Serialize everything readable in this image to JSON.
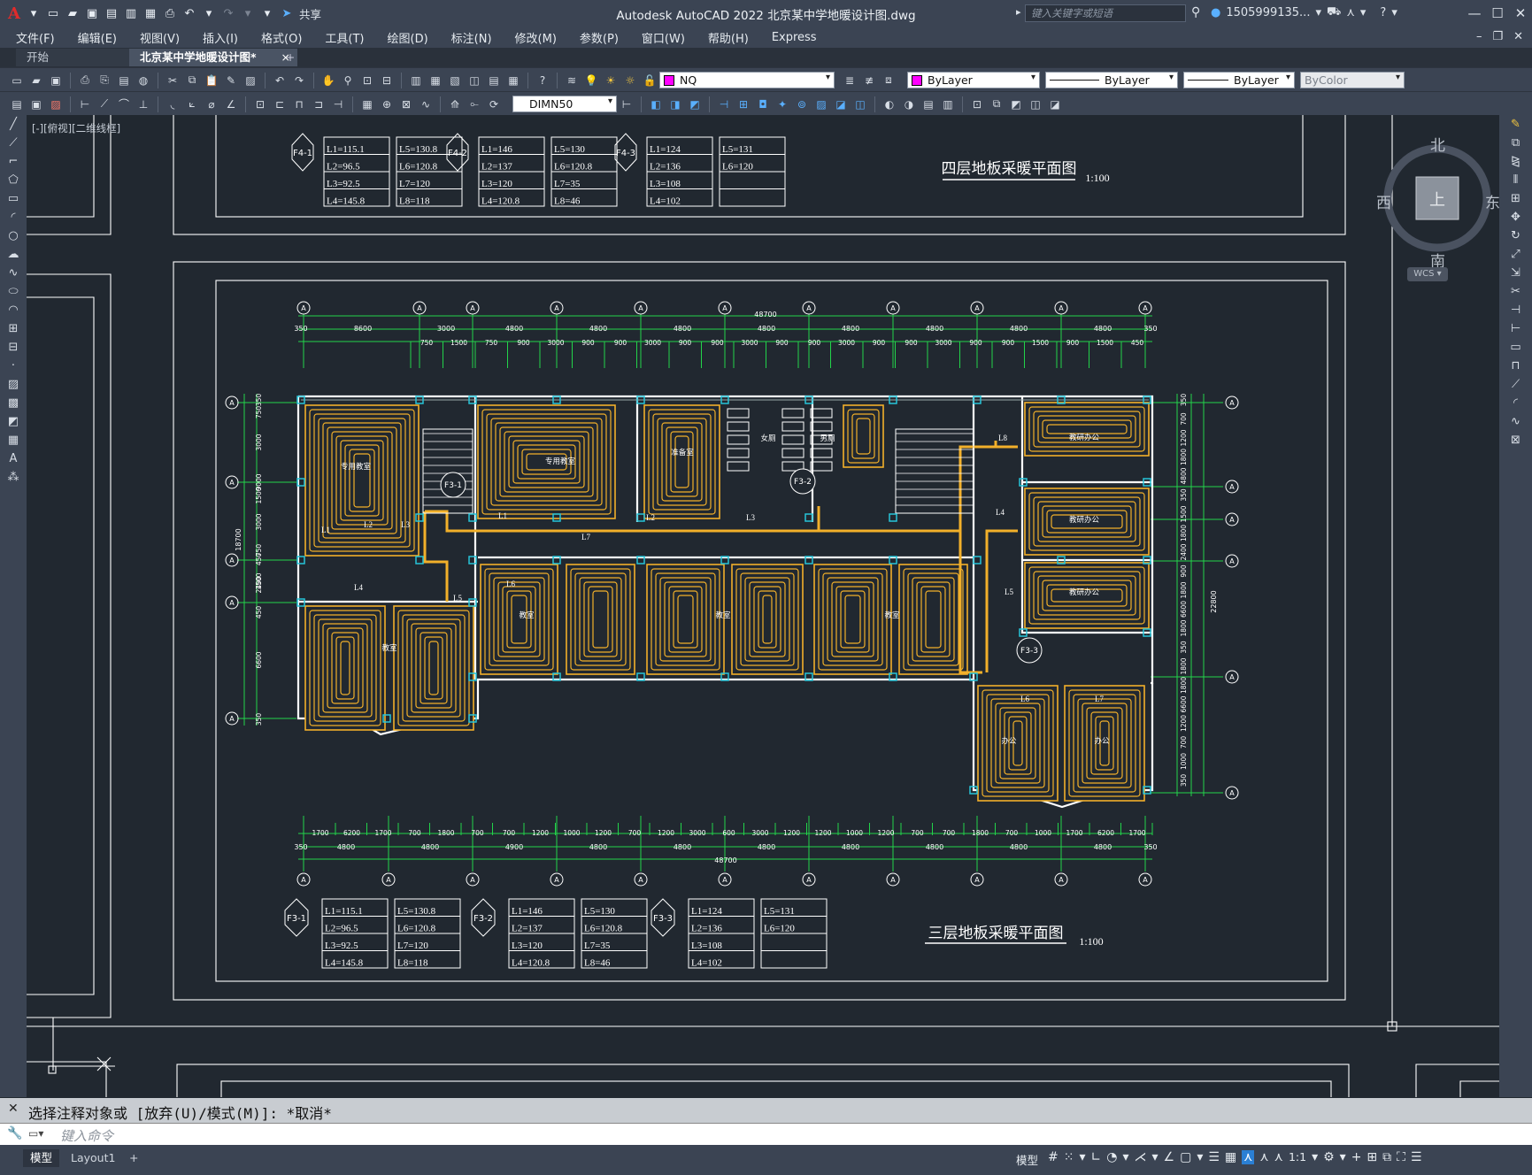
{
  "app": {
    "title": "Autodesk AutoCAD 2022    北京某中学地暖设计图.dwg",
    "search_placeholder": "键入关键字或短语",
    "user": "1505999135...",
    "share_label": "共享"
  },
  "menu": [
    "文件(F)",
    "编辑(E)",
    "视图(V)",
    "插入(I)",
    "格式(O)",
    "工具(T)",
    "绘图(D)",
    "标注(N)",
    "修改(M)",
    "参数(P)",
    "窗口(W)",
    "帮助(H)",
    "Express"
  ],
  "tabs": {
    "start": "开始",
    "doc": "北京某中学地暖设计图*",
    "close": "×",
    "add": "+"
  },
  "toolbar": {
    "layer": "NQ",
    "color": "ByLayer",
    "linetype": "ByLayer",
    "lineweight": "ByLayer",
    "plotstyle": "ByColor",
    "dimstyle": "DIMN50"
  },
  "viewport_label": "[-][俯视][二维线框]",
  "viewcube": {
    "north": "北",
    "south": "南",
    "east": "东",
    "west": "西",
    "top": "上",
    "wcs": "WCS"
  },
  "drawing": {
    "title_4f": "四层地板采暖平面图",
    "scale_4f": "1:100",
    "title_3f": "三层地板采暖平面图",
    "scale_3f": "1:100",
    "axis_label": "A",
    "tables_4f": [
      {
        "tag": "F4-1",
        "col1": [
          "L1=115.1",
          "L2=96.5",
          "L3=92.5",
          "L4=145.8"
        ],
        "col2": [
          "L5=130.8",
          "L6=120.8",
          "L7=120",
          "L8=118"
        ]
      },
      {
        "tag": "F4-2",
        "col1": [
          "L1=146",
          "L2=137",
          "L3=120",
          "L4=120.8"
        ],
        "col2": [
          "L5=130",
          "L6=120.8",
          "L7=35",
          "L8=46"
        ]
      },
      {
        "tag": "F4-3",
        "col1": [
          "L1=124",
          "L2=136",
          "L3=108",
          "L4=102"
        ],
        "col2": [
          "L5=131",
          "L6=120",
          "",
          ""
        ]
      }
    ],
    "tables_3f": [
      {
        "tag": "F3-1",
        "col1": [
          "L1=115.1",
          "L2=96.5",
          "L3=92.5",
          "L4=145.8"
        ],
        "col2": [
          "L5=130.8",
          "L6=120.8",
          "L7=120",
          "L8=118"
        ]
      },
      {
        "tag": "F3-2",
        "col1": [
          "L1=146",
          "L2=137",
          "L3=120",
          "L4=120.8"
        ],
        "col2": [
          "L5=130",
          "L6=120.8",
          "L7=35",
          "L8=46"
        ]
      },
      {
        "tag": "F3-3",
        "col1": [
          "L1=124",
          "L2=136",
          "L3=108",
          "L4=102"
        ],
        "col2": [
          "L5=131",
          "L6=120",
          "",
          ""
        ]
      }
    ],
    "dims_top_total": "48700",
    "dims_top_row1": [
      "350",
      "8600",
      "3000",
      "4800",
      "4800",
      "4800",
      "4800",
      "4800",
      "4800",
      "4800",
      "4800",
      "350"
    ],
    "dims_top_row2": [
      "750",
      "1500",
      "750",
      "900",
      "3000",
      "900",
      "900",
      "3000",
      "900",
      "900",
      "3000",
      "900",
      "900",
      "3000",
      "900",
      "900",
      "3000",
      "900",
      "900",
      "1500",
      "900",
      "1500",
      "450"
    ],
    "dims_bottom_total": "48700",
    "dims_bottom_row1": [
      "350",
      "4800",
      "4800",
      "4900",
      "4800",
      "4800",
      "4800",
      "4800",
      "4800",
      "4800",
      "4800",
      "350"
    ],
    "dims_bottom_row2": [
      "1700",
      "6200",
      "1700",
      "700",
      "1800",
      "700",
      "700",
      "1200",
      "1000",
      "1200",
      "700",
      "1200",
      "3000",
      "600",
      "3000",
      "1200",
      "1200",
      "1000",
      "1200",
      "700",
      "700",
      "1800",
      "700",
      "1000",
      "1700",
      "6200",
      "1700"
    ],
    "dims_left": [
      "350",
      "750",
      "3000",
      "9000",
      "1500",
      "3000",
      "750",
      "450",
      "1500",
      "2400",
      "450",
      "6600",
      "350"
    ],
    "dims_left_total": "18700",
    "dims_right": [
      "350",
      "700",
      "1200",
      "1800",
      "4800",
      "350",
      "1500",
      "1800",
      "2400",
      "900",
      "1800",
      "6600",
      "1800",
      "350",
      "1800",
      "1800",
      "6600",
      "1200",
      "700",
      "1000",
      "350"
    ],
    "dims_right_total": "22800",
    "room_labels": [
      "专用教室",
      "专用教室",
      "准备室",
      "女厕",
      "男厕",
      "教室",
      "教室",
      "教室",
      "教室",
      "教研办公",
      "教研办公",
      "教研办公",
      "办公",
      "办公"
    ],
    "loop_labels": [
      "L1",
      "L2",
      "L3",
      "L4",
      "L5",
      "L6",
      "L7",
      "L8"
    ],
    "manifold_tags": [
      "F3-1",
      "F3-2",
      "F3-3"
    ]
  },
  "command": {
    "history": "选择注释对象或 [放弃(U)/模式(M)]: *取消*",
    "placeholder": "键入命令"
  },
  "status": {
    "layout_tabs": [
      "模型",
      "Layout1"
    ],
    "add": "+",
    "space": "模型",
    "scale": "1:1"
  },
  "colors": {
    "background": "#212830",
    "pipe": "#f2b02a",
    "dimension": "#22d44a",
    "wall": "#ffffff",
    "column": "#27c4d8",
    "text": "#ffffff"
  }
}
